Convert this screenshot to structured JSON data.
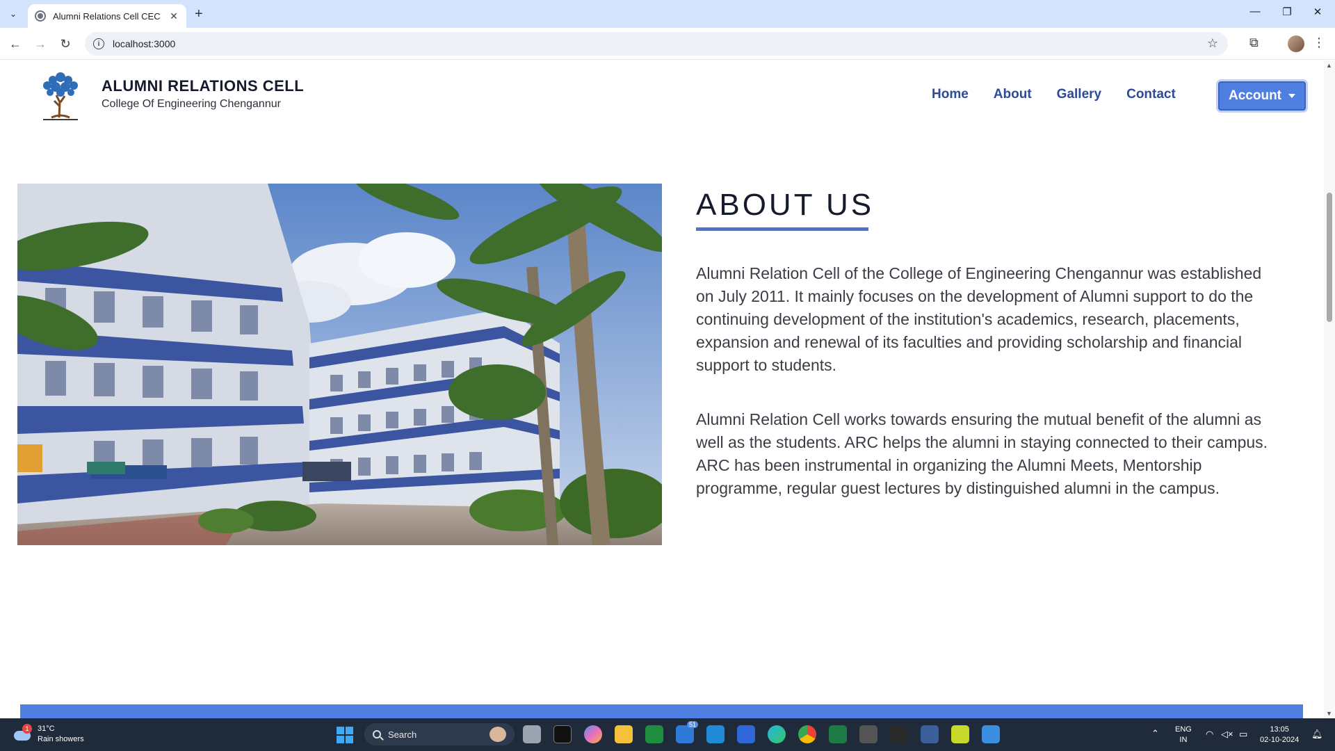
{
  "browser": {
    "tab_title": "Alumni Relations Cell CEC",
    "url": "localhost:3000"
  },
  "site": {
    "brand_title": "ALUMNI RELATIONS CELL",
    "brand_subtitle": "College Of Engineering Chengannur",
    "nav": [
      "Home",
      "About",
      "Gallery",
      "Contact"
    ],
    "account_label": "Account"
  },
  "about": {
    "heading": "ABOUT US",
    "paragraphs": [
      "Alumni Relation Cell of the College of Engineering Chengannur was established on July 2011. It mainly focuses on the development of Alumni support to do the continuing development of the institution's academics, research, placements, expansion and renewal of its faculties and providing scholarship and financial support to students.",
      "Alumni Relation Cell works towards ensuring the mutual benefit of the alumni as well as the students. ARC helps the alumni in staying connected to their campus. ARC has been instrumental in organizing the Alumni Meets, Mentorship programme, regular guest lectures by distinguished alumni in the campus."
    ]
  },
  "taskbar": {
    "weather_temp": "31°C",
    "weather_desc": "Rain showers",
    "weather_badge": "1",
    "search_label": "Search",
    "mail_badge": "51",
    "lang": "ENG",
    "region": "IN",
    "time": "13:05",
    "date": "02-10-2024"
  },
  "colors": {
    "accent": "#4f7fe0",
    "nav_text": "#2d4a9a",
    "heading_rule": "#4f73c8"
  }
}
